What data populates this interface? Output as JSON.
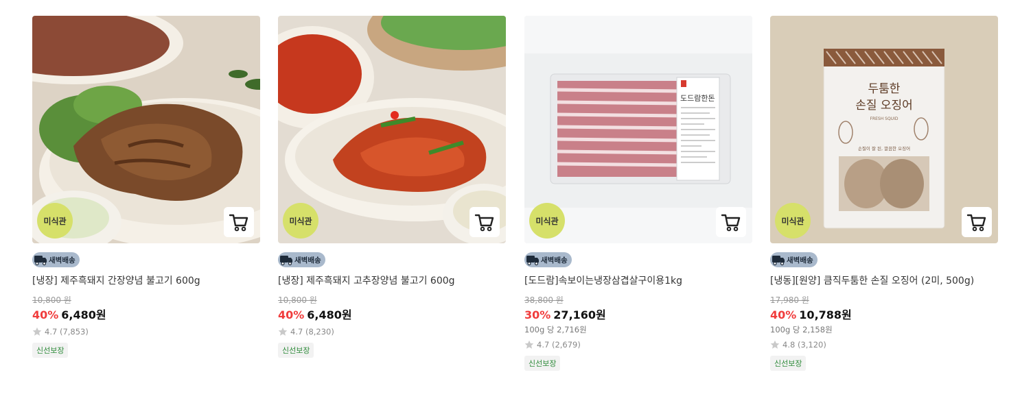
{
  "products": [
    {
      "badge": "미식관",
      "delivery": "새벽배송",
      "title": "[냉장] 제주흑돼지 간장양념 불고기 600g",
      "original_price": "10,800 원",
      "discount": "40%",
      "price": "6,480원",
      "unit_price": "",
      "rating": "4.7",
      "reviews": "(7,853)",
      "tag": "신선보장"
    },
    {
      "badge": "미식관",
      "delivery": "새벽배송",
      "title": "[냉장] 제주흑돼지 고추장양념 불고기 600g",
      "original_price": "10,800 원",
      "discount": "40%",
      "price": "6,480원",
      "unit_price": "",
      "rating": "4.7",
      "reviews": "(8,230)",
      "tag": "신선보장"
    },
    {
      "badge": "미식관",
      "delivery": "새벽배송",
      "title": "[도드람]속보이는냉장삼겹살구이용1kg",
      "original_price": "38,800 원",
      "discount": "30%",
      "price": "27,160원",
      "unit_price": "100g 당 2,716원",
      "rating": "4.7",
      "reviews": "(2,679)",
      "tag": "신선보장",
      "package_label": "도드람한돈"
    },
    {
      "badge": "미식관",
      "delivery": "새벽배송",
      "title": "[냉동][원양] 큼직두툼한 손질 오징어 (2미, 500g)",
      "original_price": "17,980 원",
      "discount": "40%",
      "price": "10,788원",
      "unit_price": "100g 당 2,158원",
      "rating": "4.8",
      "reviews": "(3,120)",
      "tag": "신선보장",
      "package_line1": "두툼한",
      "package_line2": "손질 오징어",
      "package_sub": "FRESH SQUID",
      "package_note": "손질이 잘 된, 깔끔한 오징어"
    }
  ],
  "colors": {
    "discount": "#f03c3c",
    "badge_bg": "#d6e06a",
    "delivery_bg": "#a9b9cc",
    "tag_text": "#2e8b3a"
  },
  "icons": [
    "cart-icon",
    "truck-icon",
    "star-icon"
  ]
}
